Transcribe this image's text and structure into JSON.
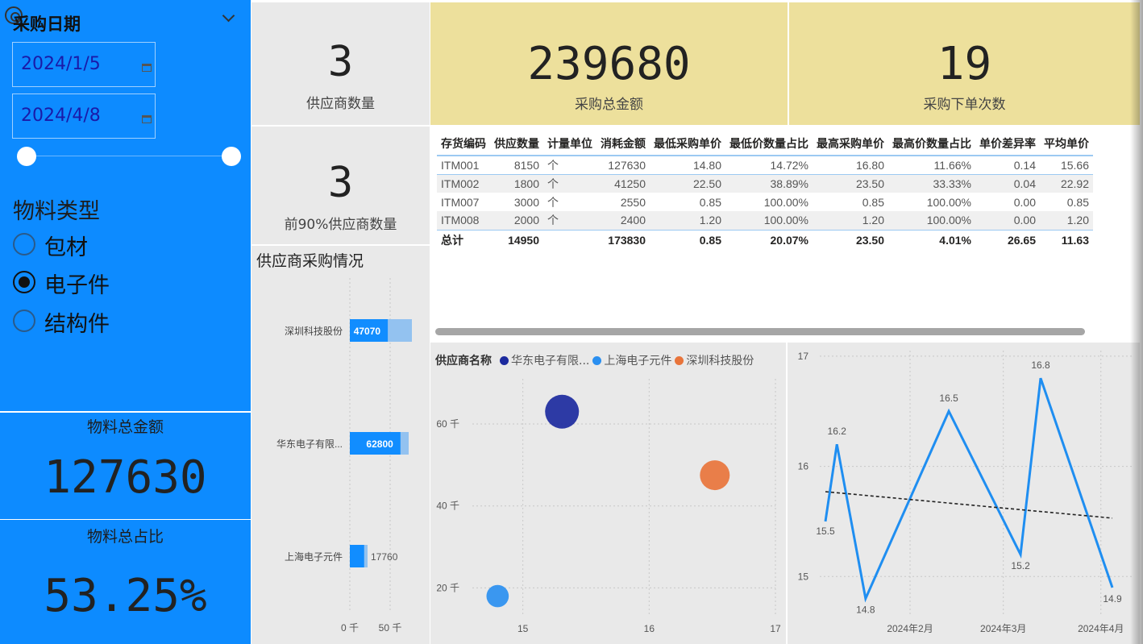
{
  "slicer_date": {
    "title": "采购日期",
    "start": "2024/1/5",
    "end": "2024/4/8"
  },
  "slicer_material": {
    "title": "物料类型",
    "options": [
      {
        "label": "包材",
        "selected": false
      },
      {
        "label": "电子件",
        "selected": true
      },
      {
        "label": "结构件",
        "selected": false
      }
    ]
  },
  "kpis": {
    "material_total_amount": {
      "label": "物料总金额",
      "value": "127630"
    },
    "material_total_ratio": {
      "label": "物料总占比",
      "value": "53.25%"
    },
    "supplier_count": {
      "label": "供应商数量",
      "value": "3"
    },
    "top90_supplier_count": {
      "label": "前90%供应商数量",
      "value": "3"
    },
    "purchase_total": {
      "label": "采购总金额",
      "value": "239680"
    },
    "order_count": {
      "label": "采购下单次数",
      "value": "19"
    }
  },
  "colors": {
    "slicer_bg": "#0d8bff",
    "kpi_yellow": "#ede09c",
    "panel_gray": "#e9e9e9",
    "bar_dark": "#118dff",
    "bar_light": "#93c2f0",
    "line_blue": "#1f8ef1",
    "huadong": "#1c2a9e",
    "shanghai": "#2a8ff0",
    "shenzhen": "#e8743b"
  },
  "table": {
    "columns": [
      "存货编码",
      "供应数量",
      "计量单位",
      "消耗金额",
      "最低采购单价",
      "最低价数量占比",
      "最高采购单价",
      "最高价数量占比",
      "单价差异率",
      "平均单价"
    ],
    "rows": [
      [
        "ITM001",
        "8150",
        "个",
        "127630",
        "14.80",
        "14.72%",
        "16.80",
        "11.66%",
        "0.14",
        "15.66"
      ],
      [
        "ITM002",
        "1800",
        "个",
        "41250",
        "22.50",
        "38.89%",
        "23.50",
        "33.33%",
        "0.04",
        "22.92"
      ],
      [
        "ITM007",
        "3000",
        "个",
        "2550",
        "0.85",
        "100.00%",
        "0.85",
        "100.00%",
        "0.00",
        "0.85"
      ],
      [
        "ITM008",
        "2000",
        "个",
        "2400",
        "1.20",
        "100.00%",
        "1.20",
        "100.00%",
        "0.00",
        "1.20"
      ]
    ],
    "total": [
      "总计",
      "14950",
      "",
      "173830",
      "0.85",
      "20.07%",
      "23.50",
      "4.01%",
      "26.65",
      "11.63"
    ]
  },
  "chart_data": [
    {
      "type": "bar",
      "title": "供应商采购情况",
      "orientation": "horizontal",
      "categories": [
        "深圳科技股份",
        "华东电子有限...",
        "上海电子元件"
      ],
      "series": [
        {
          "values": [
            47070,
            62800,
            17760
          ]
        },
        {
          "values": [
            77000,
            73000,
            22000
          ]
        }
      ],
      "data_labels": [
        "47070",
        "62800",
        "17760"
      ],
      "x_ticks": [
        "0 千",
        "50 千"
      ],
      "xlim": [
        0,
        80000
      ]
    },
    {
      "type": "scatter",
      "legend_title": "供应商名称",
      "legend": [
        "华东电子有限...",
        "上海电子元件",
        "深圳科技股份"
      ],
      "points": [
        {
          "series": "华东电子有限...",
          "x": 15.31,
          "y": 63000,
          "size": 62800
        },
        {
          "series": "上海电子元件",
          "x": 14.8,
          "y": 18000,
          "size": 17760
        },
        {
          "series": "深圳科技股份",
          "x": 16.52,
          "y": 47500,
          "size": 47070
        }
      ],
      "xlim": [
        14.6,
        17.0
      ],
      "ylim": [
        13000,
        72000
      ],
      "x_ticks": [
        "15",
        "16",
        "17"
      ],
      "y_ticks": [
        {
          "v": 20000,
          "label": "20 千"
        },
        {
          "v": 40000,
          "label": "40 千"
        },
        {
          "v": 60000,
          "label": "60 千"
        }
      ]
    },
    {
      "type": "line",
      "points": [
        {
          "t": 0.0,
          "y": 15.5
        },
        {
          "t": 0.04,
          "y": 16.2
        },
        {
          "t": 0.14,
          "y": 14.8
        },
        {
          "t": 0.43,
          "y": 16.5
        },
        {
          "t": 0.68,
          "y": 15.2
        },
        {
          "t": 0.75,
          "y": 16.8
        },
        {
          "t": 1.0,
          "y": 14.9
        }
      ],
      "data_labels": [
        "15.5",
        "16.2",
        "14.8",
        "16.5",
        "15.2",
        "16.8",
        "14.9"
      ],
      "trend": [
        {
          "t": 0.0,
          "y": 15.77
        },
        {
          "t": 1.0,
          "y": 15.53
        }
      ],
      "ylim": [
        14.6,
        17.05
      ],
      "y_ticks": [
        "15",
        "16",
        "17"
      ],
      "x_ticks": [
        "2024年2月",
        "2024年3月",
        "2024年4月"
      ]
    }
  ]
}
